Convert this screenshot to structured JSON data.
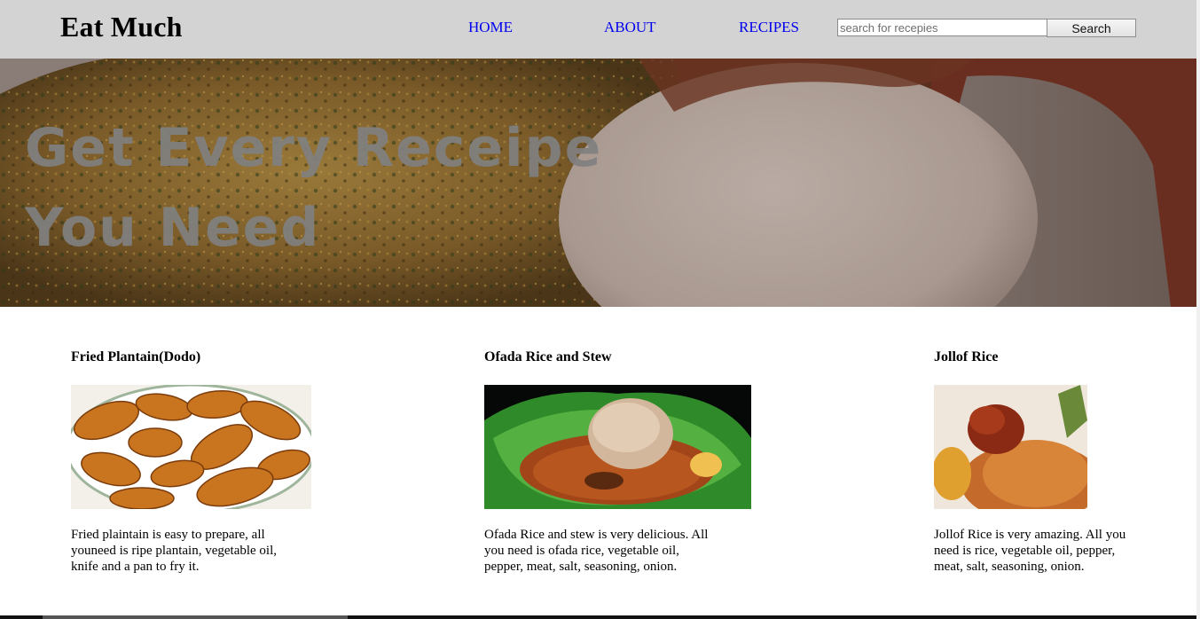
{
  "header": {
    "brand": "Eat Much",
    "nav": {
      "home": "HOME",
      "about": "ABOUT",
      "recipes": "RECIPES"
    },
    "search": {
      "placeholder": "search for recepies",
      "value": "",
      "button": "Search"
    }
  },
  "hero": {
    "title": "Get Every Receipe You Need"
  },
  "recipes": [
    {
      "title": "Fried Plantain(Dodo)",
      "description": "Fried plaintain is easy to prepare, all youneed is ripe plantain, vegetable oil, knife and a pan to fry it."
    },
    {
      "title": "Ofada Rice and Stew",
      "description": "Ofada Rice and stew is very delicious. All you need is ofada rice, vegetable oil, pepper, meat, salt, seasoning, onion."
    },
    {
      "title": "Jollof Rice",
      "description": "Jollof Rice is very amazing. All you need is rice, vegetable oil, pepper, meat, salt, seasoning, onion."
    }
  ],
  "colors": {
    "header_bg": "#d3d3d3",
    "nav_link": "#0000ee",
    "hero_title": "#808080"
  }
}
